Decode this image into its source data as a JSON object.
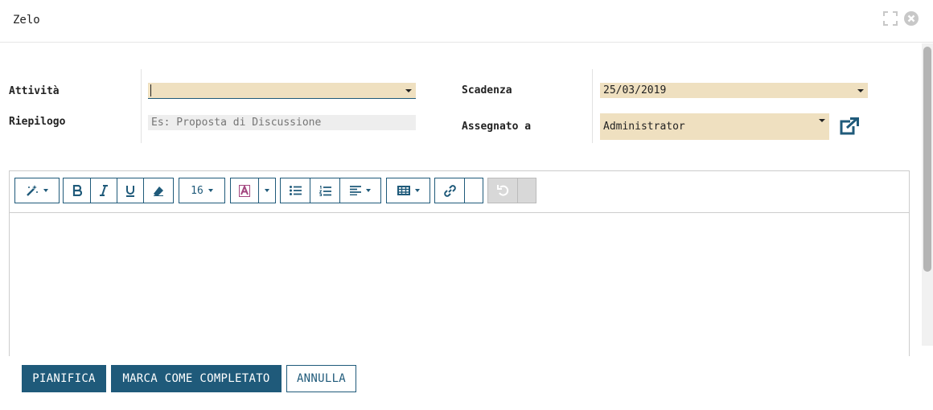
{
  "dialog": {
    "title": "Zelo"
  },
  "form": {
    "activity_label": "Attività",
    "activity_value": "",
    "summary_label": "Riepilogo",
    "summary_placeholder": "Es: Proposta di Discussione",
    "deadline_label": "Scadenza",
    "deadline_value": "25/03/2019",
    "assigned_label": "Assegnato a",
    "assigned_value": "Administrator"
  },
  "editor": {
    "font_size": "16",
    "toolbar_icons": [
      "magic-icon",
      "bold-icon",
      "italic-icon",
      "underline-icon",
      "eraser-icon",
      "font-color-icon",
      "unordered-list-icon",
      "ordered-list-icon",
      "align-icon",
      "table-icon",
      "link-icon",
      "undo-icon"
    ]
  },
  "footer": {
    "schedule_label": "PIANIFICA",
    "mark_done_label": "MARCA COME COMPLETATO",
    "cancel_label": "ANNULLA"
  },
  "colors": {
    "primary": "#1f5a7a",
    "field_bg": "#efe0c0",
    "font_color_accent": "#a3467f"
  }
}
